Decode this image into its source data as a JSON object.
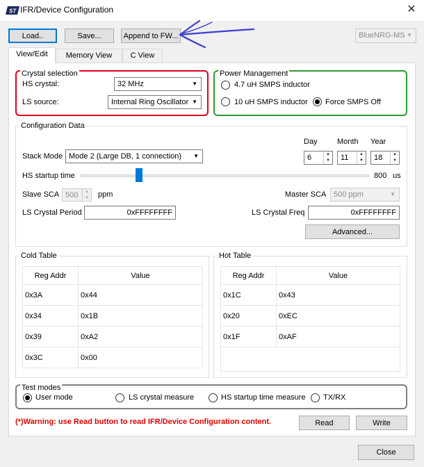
{
  "window": {
    "title": "IFR/Device Configuration",
    "close_glyph": "✕"
  },
  "toolbar": {
    "load_label": "Load..",
    "save_label": "Save...",
    "append_label": "Append to FW...",
    "device_select": "BlueNRG-MS"
  },
  "tabs": [
    {
      "label": "View/Edit"
    },
    {
      "label": "Memory View"
    },
    {
      "label": "C View"
    }
  ],
  "crystal": {
    "title": "Crystal selection",
    "hs_label": "HS crystal:",
    "hs_value": "32 MHz",
    "ls_label": "LS source:",
    "ls_value": "Internal Ring Oscillator"
  },
  "power": {
    "title": "Power Management",
    "opt1": "4.7 uH SMPS inductor",
    "opt2": "10 uH SMPS inductor",
    "opt3": "Force SMPS Off"
  },
  "config": {
    "title": "Configuration Data",
    "day_label": "Day",
    "month_label": "Month",
    "year_label": "Year",
    "day": "6",
    "month": "11",
    "year": "18",
    "stack_label": "Stack Mode",
    "stack_value": "Mode 2 (Large DB, 1 connection)",
    "hs_startup_label": "HS startup time",
    "hs_startup_value": "800",
    "hs_startup_unit": "us",
    "slave_sca_label": "Slave SCA",
    "slave_sca_value": "500",
    "slave_sca_unit": "ppm",
    "master_sca_label": "Master SCA",
    "master_sca_value": "500 ppm",
    "ls_period_label": "LS Crystal Period",
    "ls_period_value": "0xFFFFFFFF",
    "ls_freq_label": "LS Crystal Freq",
    "ls_freq_value": "0xFFFFFFFF",
    "advanced_label": "Advanced..."
  },
  "cold_table": {
    "title": "Cold Table",
    "col_addr": "Reg Addr",
    "col_value": "Value",
    "rows": [
      {
        "addr": "0x3A",
        "value": "0x44"
      },
      {
        "addr": "0x34",
        "value": "0x1B"
      },
      {
        "addr": "0x39",
        "value": "0xA2"
      },
      {
        "addr": "0x3C",
        "value": "0x00"
      }
    ]
  },
  "hot_table": {
    "title": "Hot Table",
    "col_addr": "Reg Addr",
    "col_value": "Value",
    "rows": [
      {
        "addr": "0x1C",
        "value": "0x43"
      },
      {
        "addr": "0x20",
        "value": "0xEC"
      },
      {
        "addr": "0x1F",
        "value": "0xAF"
      }
    ]
  },
  "test_modes": {
    "title": "Test modes",
    "opt1": "User mode",
    "opt2": "LS crystal measure",
    "opt3": "HS startup time measure",
    "opt4": "TX/RX"
  },
  "footer": {
    "warning": "(*)Warning: use Read button to read IFR/Device Configuration content.",
    "read_label": "Read",
    "write_label": "Write",
    "close_label": "Close"
  },
  "colors": {
    "crystal_border": "#e0001b",
    "power_border": "#2e9a2e",
    "accent": "#0078d7",
    "annotation_arrow": "#3d3dd6"
  }
}
